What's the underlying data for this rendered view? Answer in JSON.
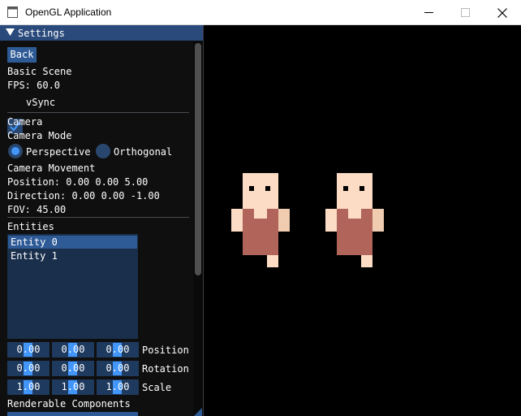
{
  "window": {
    "title": "OpenGL Application"
  },
  "settings": {
    "title": "Settings",
    "back_label": "Back",
    "scene_name": "Basic Scene",
    "fps_text": "FPS: 60.0",
    "vsync_label": "vSync",
    "vsync_checked": true,
    "camera_heading": "Camera",
    "camera_mode_label": "Camera Mode",
    "camera_modes": [
      {
        "label": "Perspective",
        "selected": true
      },
      {
        "label": "Orthogonal",
        "selected": false
      }
    ],
    "camera_movement_label": "Camera Movement",
    "position_text": "Position: 0.00 0.00 5.00",
    "direction_text": "Direction: 0.00 0.00 -1.00",
    "fov_text": "FOV: 45.00",
    "entities_heading": "Entities",
    "entities": [
      {
        "label": "Entity 0",
        "selected": true
      },
      {
        "label": "Entity 1",
        "selected": false
      }
    ],
    "transform_rows": [
      {
        "label": "Position",
        "values": [
          "0.00",
          "0.00",
          "0.00"
        ]
      },
      {
        "label": "Rotation",
        "values": [
          "0.00",
          "0.00",
          "0.00"
        ]
      },
      {
        "label": "Scale",
        "values": [
          "1.00",
          "1.00",
          "1.00"
        ]
      }
    ],
    "renderable_components_label": "Renderable Components"
  },
  "colors": {
    "accent": "#4296fa",
    "header": "#2a4a7c",
    "button": "#2e5a96",
    "frame": "#1f3a5f",
    "skin": "#fcdcc4",
    "skin_shade": "#f0cdb0",
    "tunic": "#b0645a",
    "eyes": "#000000"
  }
}
